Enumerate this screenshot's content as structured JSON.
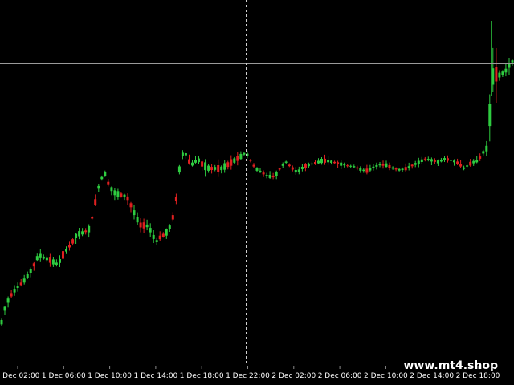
{
  "chart": {
    "background_color": "#000000",
    "bull_color": "#2ecc40",
    "bear_color": "#e02020",
    "grid_color": "#9a9a9a",
    "crosshair_color": "#cfcfcf",
    "bars_left_to_right": [
      1,
      1,
      1,
      0,
      1,
      1,
      0,
      1,
      1,
      1,
      0,
      1,
      1,
      1,
      1,
      0,
      1,
      1,
      1,
      0,
      1,
      0,
      0,
      1,
      1,
      1,
      0,
      1,
      0,
      0,
      1,
      1,
      1,
      0,
      1,
      1,
      1,
      0,
      1,
      0,
      0,
      1,
      1,
      0,
      0,
      1,
      1,
      1,
      1,
      0,
      0,
      1,
      1,
      0,
      0,
      1,
      1,
      1,
      0,
      1,
      1,
      1,
      0,
      1,
      1,
      0,
      1,
      0,
      1,
      1,
      0,
      0,
      1,
      0,
      1,
      1,
      1,
      0,
      0,
      1,
      1,
      0,
      1,
      1,
      0,
      1,
      0,
      1,
      1,
      0,
      0,
      1,
      1,
      1,
      0,
      1,
      1,
      0,
      1,
      1,
      0,
      1,
      1,
      0,
      0,
      1,
      1,
      0,
      1,
      1,
      0,
      1,
      1,
      0,
      1,
      1,
      1,
      1,
      0,
      1,
      0,
      1,
      0,
      1,
      1,
      0,
      1,
      0,
      1,
      1,
      1,
      0,
      1,
      1,
      0,
      1,
      1,
      1,
      0,
      1,
      1,
      0,
      0,
      1,
      1,
      0,
      1,
      1,
      0,
      1,
      1,
      1,
      1,
      0,
      1,
      1,
      1,
      1,
      1
    ]
  },
  "time_axis": {
    "labels": [
      "1 Dec 02:00",
      "1 Dec 06:00",
      "1 Dec 10:00",
      "1 Dec 14:00",
      "1 Dec 18:00",
      "1 Dec 22:00",
      "2 Dec 02:00",
      "2 Dec 06:00",
      "2 Dec 10:00",
      "2 Dec 14:00",
      "2 Dec 18:00"
    ],
    "label_color": "#ffffff"
  },
  "watermark": {
    "text": "www.mt4.shop"
  }
}
